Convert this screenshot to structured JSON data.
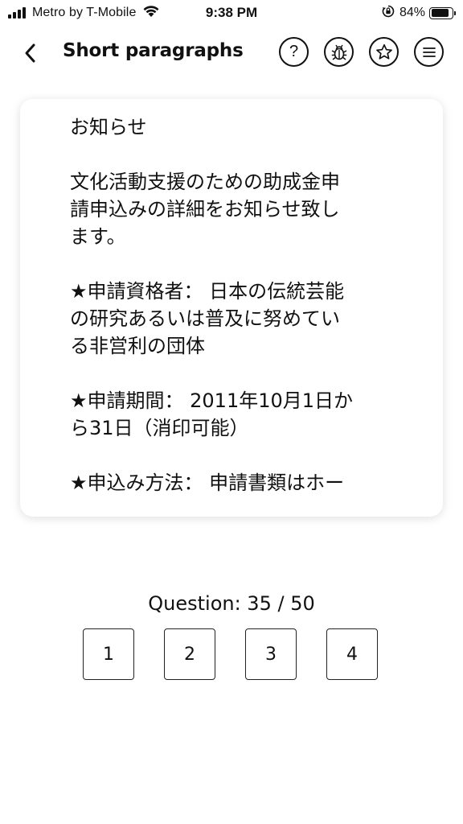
{
  "status_bar": {
    "carrier": "Metro by T-Mobile",
    "time": "9:38 PM",
    "battery_percent": "84%",
    "battery_level": 0.84,
    "signal_icon": "cellular-signal-icon",
    "wifi_icon": "wifi-icon",
    "rotation_lock_icon": "rotation-lock-icon"
  },
  "header": {
    "title": "Short paragraphs",
    "back_icon": "chevron-left-icon",
    "help_label": "?",
    "icons": [
      "help-icon",
      "bug-report-icon",
      "favorite-star-icon",
      "menu-icon"
    ]
  },
  "card": {
    "paragraphs": [
      "お知らせ",
      "文化活動支援のための助成金申\n請申込みの詳細をお知らせ致し\nます。",
      "★申請資格者： 日本の伝統芸能\nの研究あるいは普及に努めてい\nる非営利の団体",
      "★申請期間： 2011年10月1日か\nら31日（消印可能）",
      "★申込み方法： 申請書類はホー"
    ]
  },
  "question": {
    "counter": "Question: 35 / 50",
    "options": [
      "1",
      "2",
      "3",
      "4"
    ]
  },
  "colors": {
    "text": "#111111",
    "background": "#ffffff",
    "card_shadow": "rgba(0,0,0,0.13)"
  }
}
